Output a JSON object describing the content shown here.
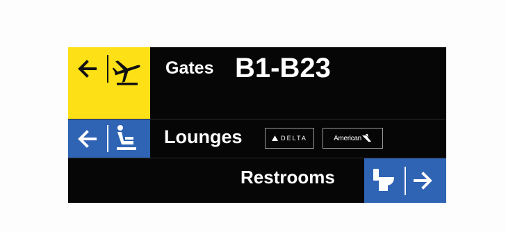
{
  "gates": {
    "label": "Gates",
    "range": "B1-B23",
    "arrow_icon": "arrow-left-icon",
    "pictogram_icon": "departing-plane-icon",
    "panel_color": "#fde016"
  },
  "lounges": {
    "label": "Lounges",
    "arrow_icon": "arrow-left-icon",
    "pictogram_icon": "lounge-seat-icon",
    "panel_color": "#2f63b4",
    "airline_logos": [
      {
        "name": "DELTA",
        "icon": "delta-widget-icon"
      },
      {
        "name": "American",
        "icon": "american-flight-symbol-icon"
      }
    ]
  },
  "restrooms": {
    "label": "Restrooms",
    "pictogram_icon": "toilet-icon",
    "arrow_icon": "arrow-right-icon",
    "panel_color": "#2f63b4"
  },
  "colors": {
    "sign_background": "#060606",
    "text": "#ffffff",
    "page_background": "#fdfdfd"
  }
}
